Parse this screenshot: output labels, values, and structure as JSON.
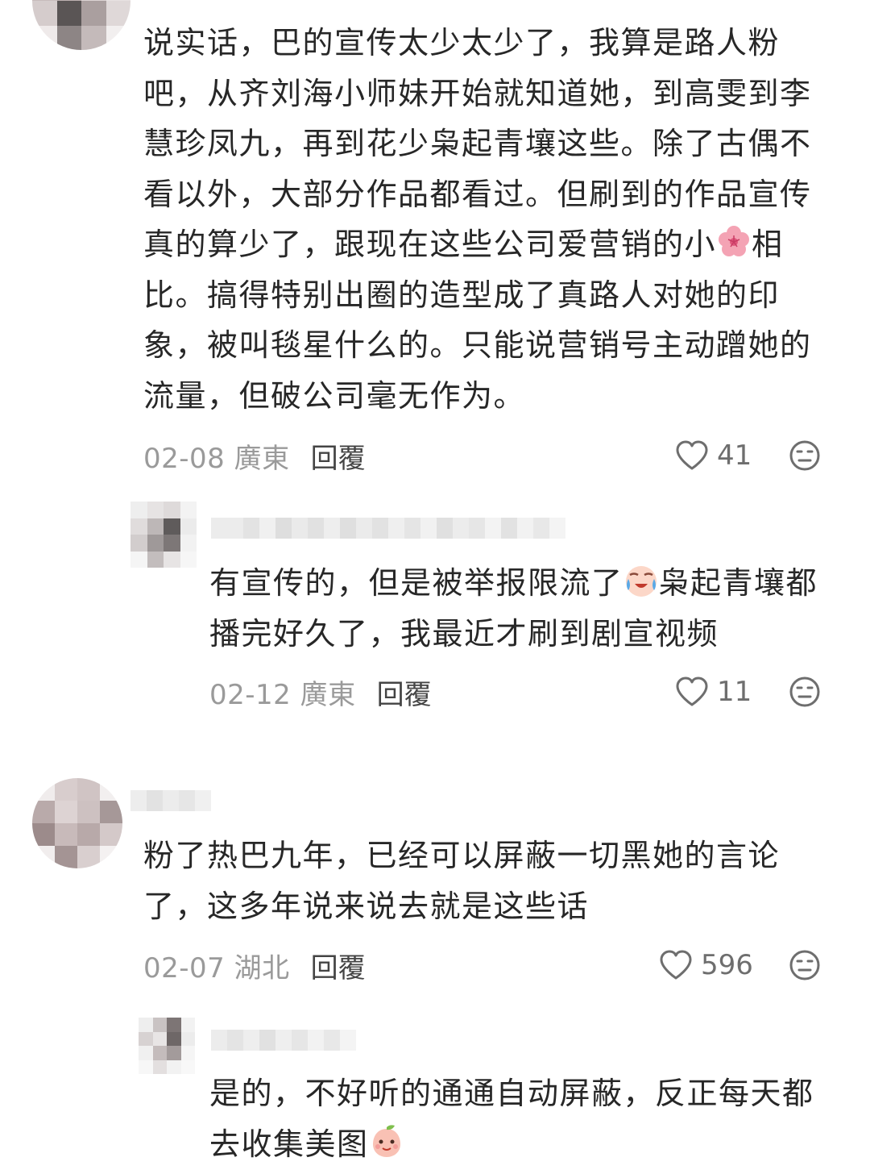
{
  "comments": [
    {
      "text_before": "说实话，巴的宣传太少太少了，我算是路人粉吧，从齐刘海小师妹开始就知道她，到高雯到李慧珍凤九，再到花少枭起青壤这些。除了古偶不看以外，大部分作品都看过。但刷到的作品宣传真的算少了，跟现在这些公司爱营销的小",
      "emoji": "flower-emoji",
      "text_after": "相比。搞得特别出圈的造型成了真路人对她的印象，被叫毯星什么的。只能说营销号主动蹭她的流量，但破公司毫无作为。",
      "date": "02-08 廣東",
      "reply_label": "回覆",
      "likes": "41"
    },
    {
      "text_before": "有宣传的，但是被举报限流了",
      "emoji": "crying-face-emoji",
      "text_after": "枭起青壤都播完好久了，我最近才刷到剧宣视频",
      "date": "02-12 廣東",
      "reply_label": "回覆",
      "likes": "11"
    },
    {
      "text_before": "粉了热巴九年，已经可以屏蔽一切黑她的言论了，这多年说来说去就是这些话",
      "date": "02-07 湖北",
      "reply_label": "回覆",
      "likes": "596"
    },
    {
      "text_before": "是的，不好听的通通自动屏蔽，反正每天都去收集美图",
      "emoji": "peach-face-emoji"
    }
  ],
  "colors": {
    "text": "#272727",
    "meta": "#9a9a9a",
    "reply": "#444444"
  }
}
